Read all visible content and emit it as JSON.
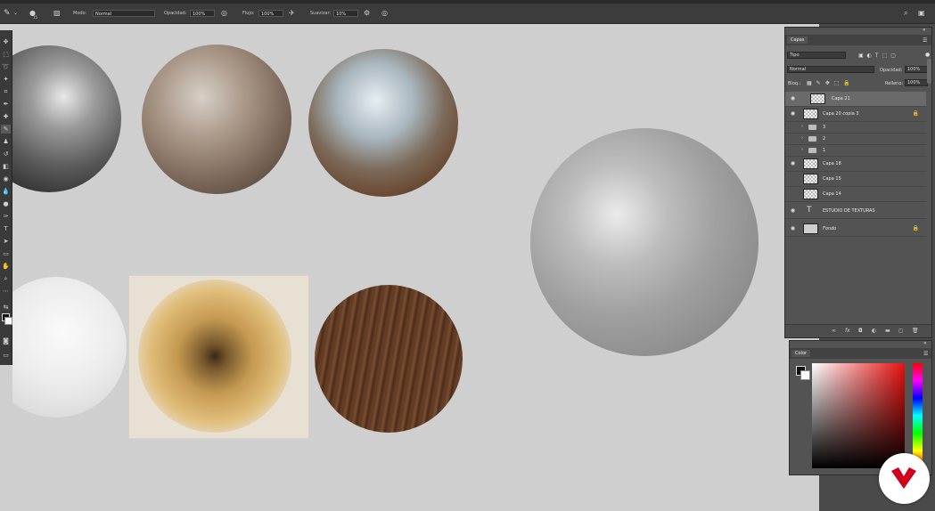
{
  "options": {
    "mode_label": "Modo:",
    "mode_value": "Normal",
    "opacity_label": "Opacidad:",
    "opacity_value": "100%",
    "flow_label": "Flujo:",
    "flow_value": "100%",
    "smoothing_label": "Suavizar:",
    "smoothing_value": "10%",
    "brush_size": "15"
  },
  "layers_panel": {
    "tab": "Capas",
    "filter": "Tipo",
    "blend_mode": "Normal",
    "opacity_label": "Opacidad:",
    "opacity_value": "100%",
    "lock_label": "Bloq.:",
    "fill_label": "Relleno:",
    "fill_value": "100%",
    "layers": [
      {
        "name": "Capa 21"
      },
      {
        "name": "Capa 20 copia 3"
      },
      {
        "name": "3"
      },
      {
        "name": "2"
      },
      {
        "name": "1"
      },
      {
        "name": "Capa 18"
      },
      {
        "name": "Capa 15"
      },
      {
        "name": "Capa 14"
      },
      {
        "name": "ESTUDIO DE TEXTURAS"
      },
      {
        "name": "Fondo"
      }
    ]
  },
  "color_panel": {
    "tab": "Color"
  },
  "icons": [
    "brush-icon",
    "eye-icon",
    "folder-icon",
    "lock-icon",
    "search-icon",
    "text-icon",
    "trash-icon"
  ]
}
